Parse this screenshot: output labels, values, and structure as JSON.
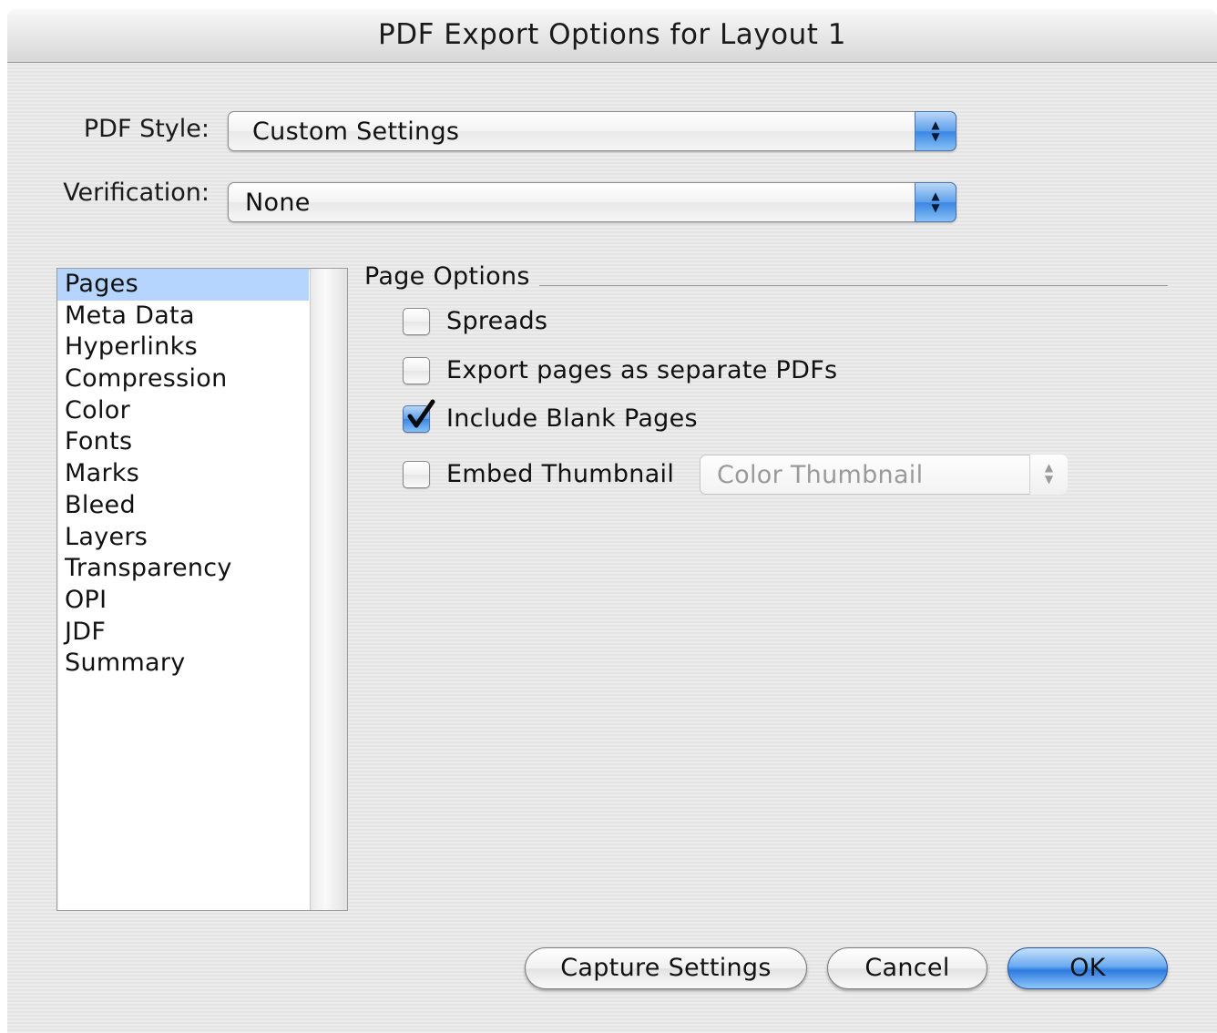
{
  "window": {
    "title": "PDF Export Options for Layout 1"
  },
  "style_row": {
    "label": "PDF Style:",
    "value": "Custom Settings"
  },
  "verification_row": {
    "label": "Verification:",
    "value": "None"
  },
  "sidebar": {
    "selected": "Pages",
    "items": [
      "Pages",
      "Meta Data",
      "Hyperlinks",
      "Compression",
      "Color",
      "Fonts",
      "Marks",
      "Bleed",
      "Layers",
      "Transparency",
      "OPI",
      "JDF",
      "Summary"
    ]
  },
  "page_options": {
    "title": "Page Options",
    "spreads": {
      "label": "Spreads",
      "checked": false
    },
    "separate_pdfs": {
      "label": "Export pages as separate PDFs",
      "checked": false
    },
    "blank_pages": {
      "label": "Include Blank Pages",
      "checked": true
    },
    "thumbnail": {
      "label": "Embed Thumbnail",
      "checked": false,
      "type": "Color Thumbnail",
      "enabled": false
    }
  },
  "buttons": {
    "capture": "Capture Settings",
    "cancel": "Cancel",
    "ok": "OK"
  },
  "colors": {
    "accent": "#3a86e4",
    "selection": "#b5d5fe"
  }
}
